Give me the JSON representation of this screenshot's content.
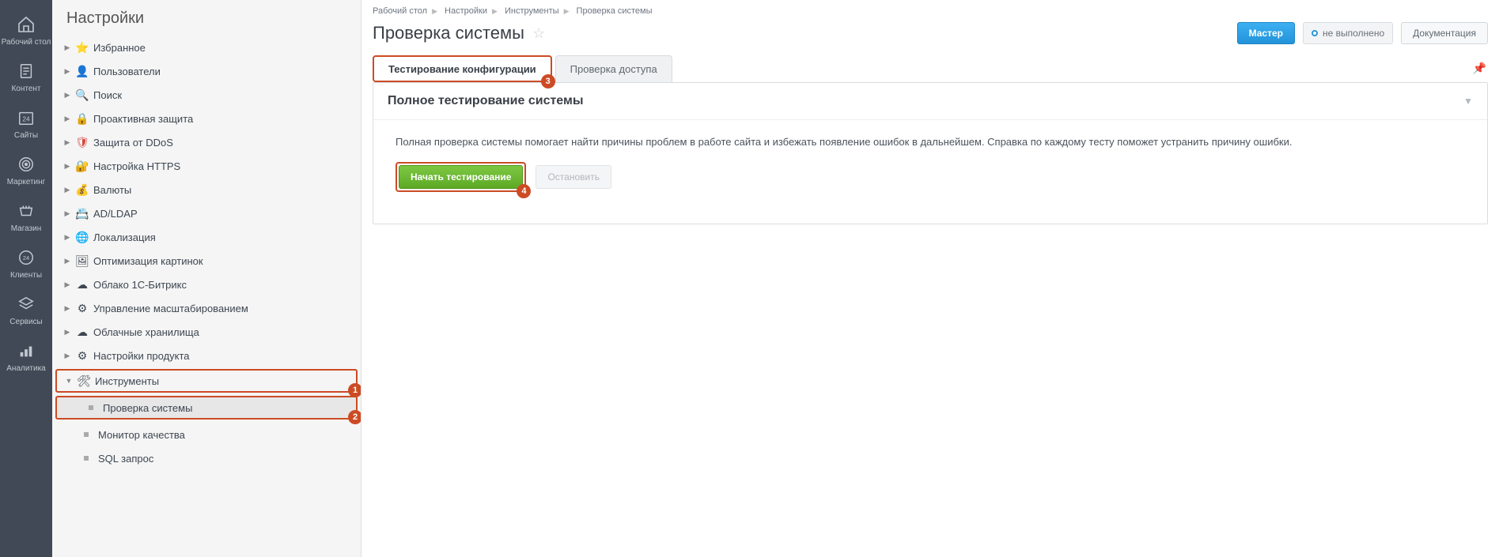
{
  "leftnav": [
    {
      "label": "Рабочий стол",
      "icon": "house"
    },
    {
      "label": "Контент",
      "icon": "doc"
    },
    {
      "label": "Сайты",
      "icon": "calendar24"
    },
    {
      "label": "Маркетинг",
      "icon": "target"
    },
    {
      "label": "Магазин",
      "icon": "cart"
    },
    {
      "label": "Клиенты",
      "icon": "clients"
    },
    {
      "label": "Сервисы",
      "icon": "layers"
    },
    {
      "label": "Аналитика",
      "icon": "chart"
    }
  ],
  "sidebar": {
    "title": "Настройки",
    "items": [
      {
        "label": "Избранное",
        "icon": "⭐",
        "color": "#e8a03a"
      },
      {
        "label": "Пользователи",
        "icon": "👤",
        "color": "#b58a5a"
      },
      {
        "label": "Поиск",
        "icon": "🔍",
        "color": "#7a8590"
      },
      {
        "label": "Проактивная защита",
        "icon": "🔒",
        "color": "#d99a3f"
      },
      {
        "label": "Защита от DDoS",
        "icon": "🛡",
        "color": "#d8493e"
      },
      {
        "label": "Настройка HTTPS",
        "icon": "🔐",
        "color": "#2f8cd8"
      },
      {
        "label": "Валюты",
        "icon": "💰",
        "color": "#d2a94a"
      },
      {
        "label": "AD/LDAP",
        "icon": "📇",
        "color": "#6f8aa3"
      },
      {
        "label": "Локализация",
        "icon": "🌐",
        "color": "#4aa3d8"
      },
      {
        "label": "Оптимизация картинок",
        "icon": "🖼",
        "color": "#6f8aa3"
      },
      {
        "label": "Облако 1С-Битрикс",
        "icon": "☁",
        "color": "#6f8aa3"
      },
      {
        "label": "Управление масштабированием",
        "icon": "⚙",
        "color": "#6f8aa3"
      },
      {
        "label": "Облачные хранилища",
        "icon": "☁",
        "color": "#6f8aa3"
      },
      {
        "label": "Настройки продукта",
        "icon": "⚙",
        "color": "#6f8aa3"
      }
    ],
    "tools": {
      "label": "Инструменты",
      "icon": "🛠",
      "badge": "1",
      "children": [
        {
          "label": "Проверка системы",
          "selected": true,
          "badge": "2"
        },
        {
          "label": "Монитор качества"
        },
        {
          "label": "SQL запрос"
        }
      ]
    }
  },
  "breadcrumb": [
    "Рабочий стол",
    "Настройки",
    "Инструменты",
    "Проверка системы"
  ],
  "page": {
    "title": "Проверка системы",
    "master_btn": "Мастер",
    "status": "не выполнено",
    "doc_btn": "Документация"
  },
  "tabs": [
    {
      "label": "Тестирование конфигурации",
      "active": true,
      "badge": "3"
    },
    {
      "label": "Проверка доступа"
    }
  ],
  "panel": {
    "title": "Полное тестирование системы",
    "desc": "Полная проверка системы помогает найти причины проблем в работе сайта и избежать появление ошибок в дальнейшем. Справка по каждому тесту поможет устранить причину ошибки.",
    "start_btn": "Начать тестирование",
    "start_badge": "4",
    "stop_btn": "Остановить"
  }
}
